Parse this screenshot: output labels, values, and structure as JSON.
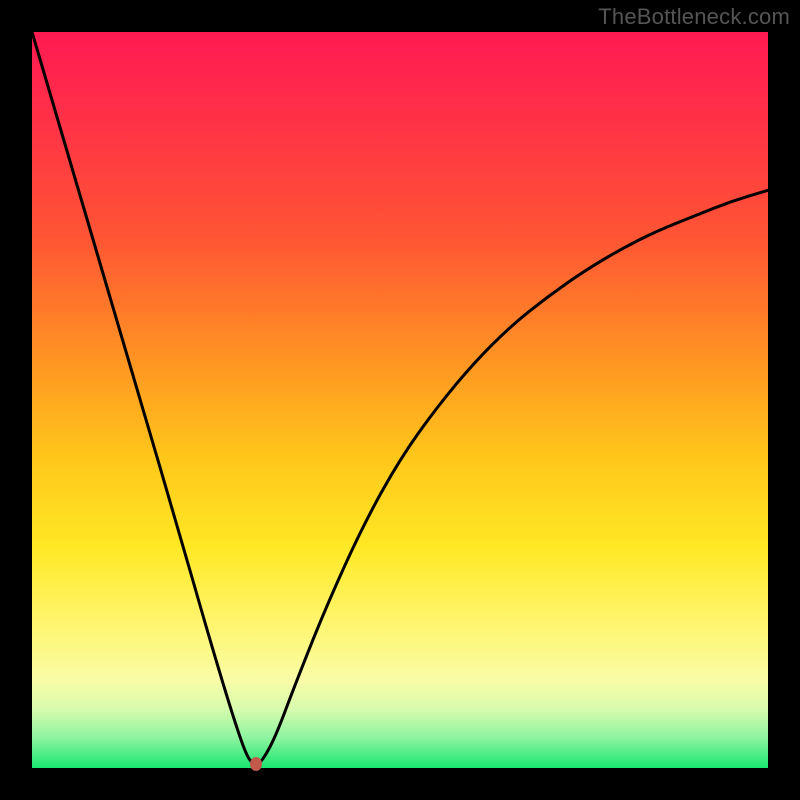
{
  "watermark": "TheBottleneck.com",
  "chart_data": {
    "type": "line",
    "title": "",
    "xlabel": "",
    "ylabel": "",
    "xlim": [
      0,
      100
    ],
    "ylim": [
      0,
      100
    ],
    "series": [
      {
        "name": "bottleneck-curve",
        "x": [
          0,
          5,
          10,
          15,
          20,
          24,
          27,
          29,
          30,
          31,
          33,
          36,
          40,
          45,
          50,
          55,
          60,
          65,
          70,
          75,
          80,
          85,
          90,
          95,
          100
        ],
        "y": [
          100,
          83,
          66,
          49,
          32,
          18,
          8,
          2,
          0.5,
          0.5,
          4,
          12,
          22,
          33,
          42,
          49,
          55,
          60,
          64,
          67.5,
          70.5,
          73,
          75,
          77,
          78.5
        ]
      }
    ],
    "minimum_marker": {
      "x": 30.5,
      "y": 0.5
    },
    "gradient_stops": [
      {
        "pos": 0,
        "color": "#ff1a52"
      },
      {
        "pos": 45,
        "color": "#ff9622"
      },
      {
        "pos": 70,
        "color": "#ffe825"
      },
      {
        "pos": 96,
        "color": "#8bf49f"
      },
      {
        "pos": 100,
        "color": "#18e66f"
      }
    ]
  }
}
